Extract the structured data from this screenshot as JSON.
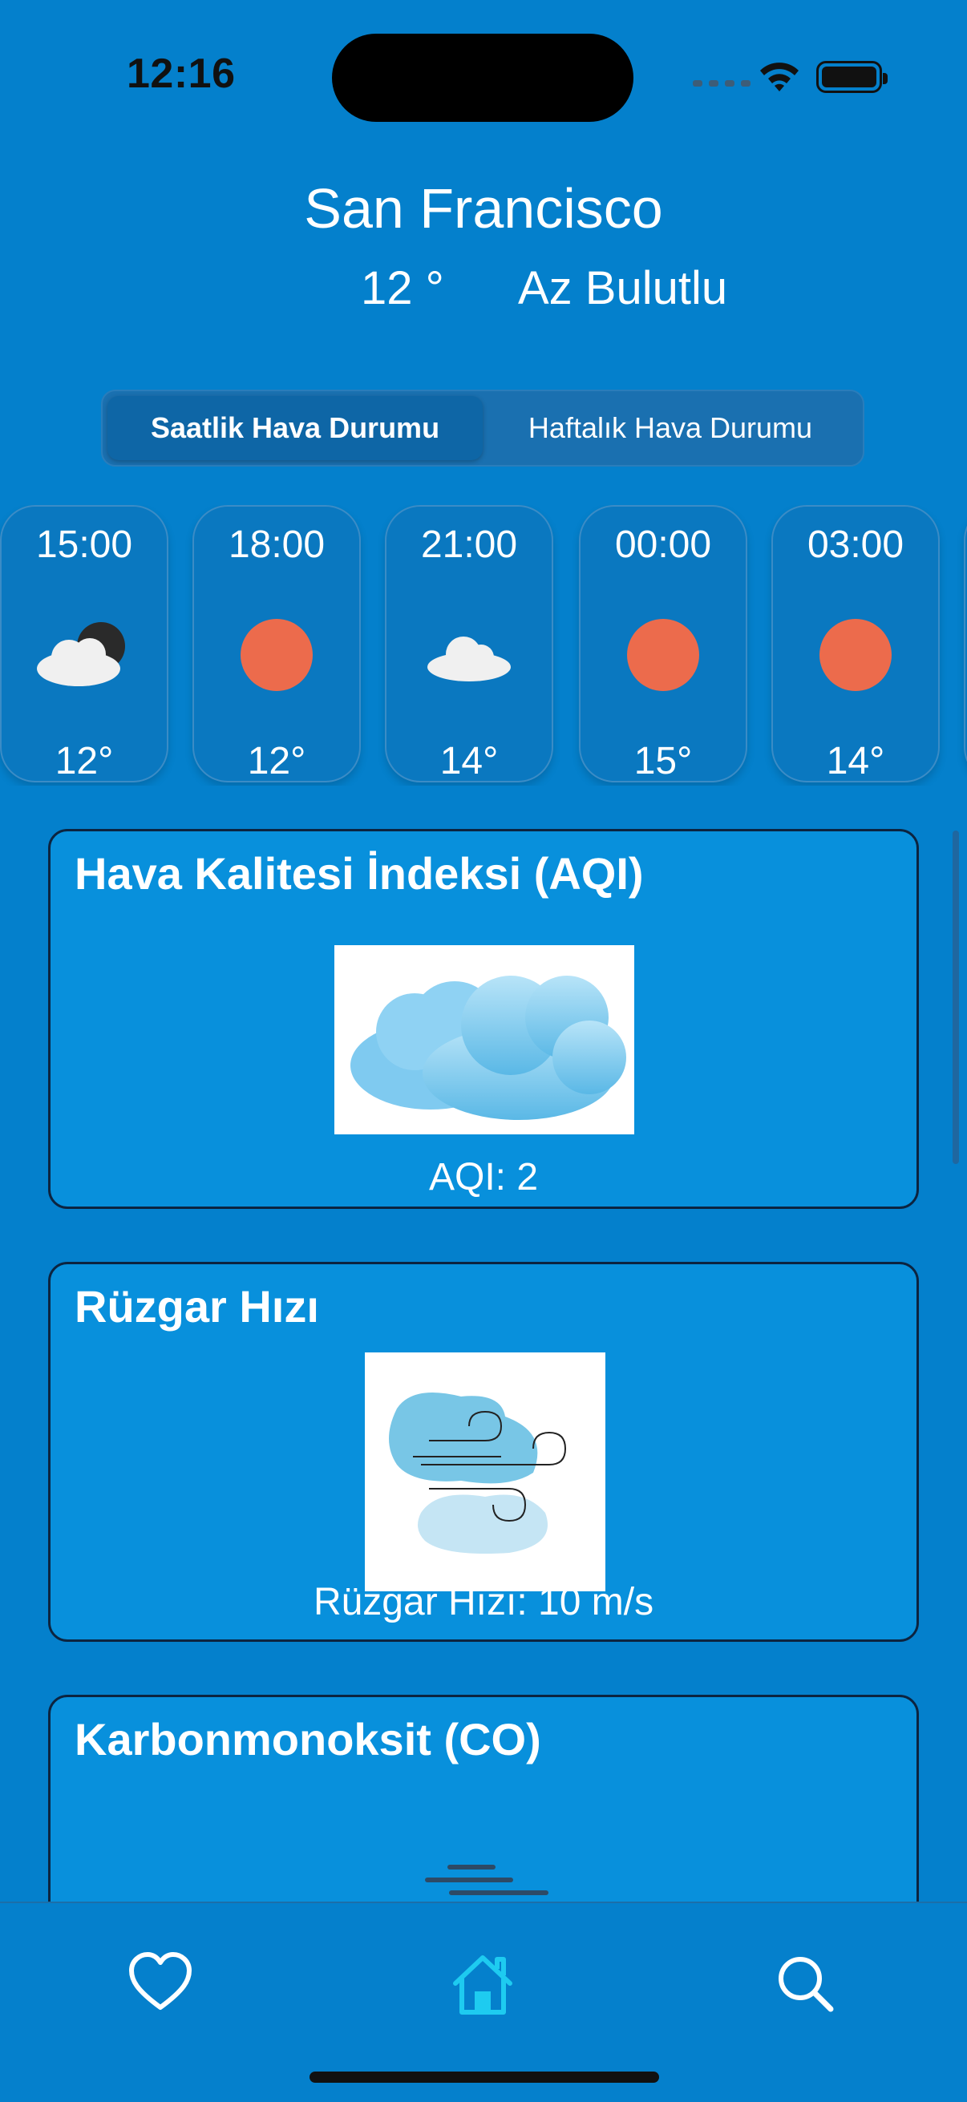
{
  "status_bar": {
    "time": "12:16"
  },
  "header": {
    "city": "San Francisco",
    "temperature": "12 °",
    "condition": "Az Bulutlu"
  },
  "segments": [
    {
      "label": "Saatlik Hava Durumu",
      "active": true
    },
    {
      "label": "Haftalık Hava Durumu",
      "active": false
    }
  ],
  "hourly": [
    {
      "time": "15:00",
      "temp": "12°",
      "icon": "cloud-moon-icon"
    },
    {
      "time": "18:00",
      "temp": "12°",
      "icon": "sun-icon"
    },
    {
      "time": "21:00",
      "temp": "14°",
      "icon": "cloud-icon"
    },
    {
      "time": "00:00",
      "temp": "15°",
      "icon": "sun-icon"
    },
    {
      "time": "03:00",
      "temp": "14°",
      "icon": "sun-icon"
    }
  ],
  "cards": {
    "aqi": {
      "title": "Hava Kalitesi İndeksi (AQI)",
      "value": "AQI: 2",
      "image": "cloud-image"
    },
    "wind": {
      "title": "Rüzgar Hızı",
      "value": "Rüzgar Hızı: 10 m/s",
      "image": "wind-image"
    },
    "co": {
      "title": "Karbonmonoksit (CO)"
    }
  },
  "tab_bar": {
    "items": [
      {
        "name": "favorites",
        "icon": "heart-icon"
      },
      {
        "name": "home",
        "icon": "home-icon",
        "active": true
      },
      {
        "name": "search",
        "icon": "search-icon"
      }
    ]
  },
  "colors": {
    "background": "#0480cc",
    "card": "#0890dc",
    "sun": "#ec6b4c",
    "active_tab": "#1ecbf0"
  }
}
